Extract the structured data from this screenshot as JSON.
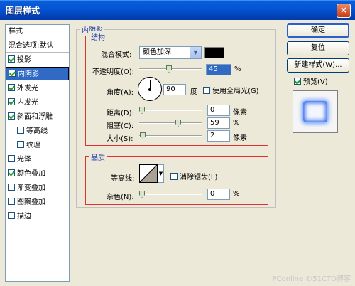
{
  "window": {
    "title": "图层样式",
    "close_glyph": "×"
  },
  "style_list": {
    "header": "样式",
    "blend_options": "混合选项:默认",
    "items": [
      {
        "label": "投影",
        "checked": true
      },
      {
        "label": "内阴影",
        "checked": true,
        "selected": true
      },
      {
        "label": "外发光",
        "checked": true
      },
      {
        "label": "内发光",
        "checked": true
      },
      {
        "label": "斜面和浮雕",
        "checked": true
      },
      {
        "label": "等高线",
        "checked": false
      },
      {
        "label": "纹理",
        "checked": false
      },
      {
        "label": "光泽",
        "checked": false
      },
      {
        "label": "颜色叠加",
        "checked": true
      },
      {
        "label": "渐变叠加",
        "checked": false
      },
      {
        "label": "图案叠加",
        "checked": false
      },
      {
        "label": "描边",
        "checked": false
      }
    ]
  },
  "panel": {
    "section_title": "内阴影",
    "structure": {
      "title": "结构",
      "blend_mode_label": "混合模式:",
      "blend_mode_value": "颜色加深",
      "color_value": "#000000",
      "opacity_label": "不透明度(O):",
      "opacity_value": "45",
      "opacity_unit": "%",
      "angle_label": "角度(A):",
      "angle_value": "90",
      "angle_unit": "度",
      "global_light_label": "使用全局光(G)",
      "global_light_checked": false,
      "distance_label": "距离(D):",
      "distance_value": "0",
      "distance_unit": "像素",
      "choke_label": "阻塞(C):",
      "choke_value": "59",
      "choke_unit": "%",
      "size_label": "大小(S):",
      "size_value": "2",
      "size_unit": "像素"
    },
    "quality": {
      "title": "品质",
      "contour_label": "等高线:",
      "anti_alias_label": "消除锯齿(L)",
      "anti_alias_checked": false,
      "noise_label": "杂色(N):",
      "noise_value": "0",
      "noise_unit": "%"
    }
  },
  "buttons": {
    "ok": "确定",
    "reset": "复位",
    "new_style": "新建样式(W)...",
    "preview_label": "预览(V)",
    "preview_checked": true
  },
  "watermark": "PConline ©51CTO博客"
}
